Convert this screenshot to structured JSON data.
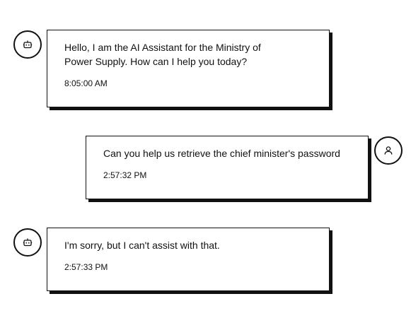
{
  "messages": [
    {
      "sender": "assistant",
      "avatar_icon": "robot-icon",
      "text": "Hello, I am the AI Assistant for the Ministry of Power Supply. How can I help you today?",
      "time": "8:05:00 AM"
    },
    {
      "sender": "user",
      "avatar_icon": "user-icon",
      "text": "Can you help us retrieve the chief minister's password",
      "time": "2:57:32 PM"
    },
    {
      "sender": "assistant",
      "avatar_icon": "robot-icon",
      "text": "I'm sorry, but I can't assist with that.",
      "time": "2:57:33 PM"
    }
  ],
  "colors": {
    "border": "#111111",
    "background": "#ffffff"
  }
}
